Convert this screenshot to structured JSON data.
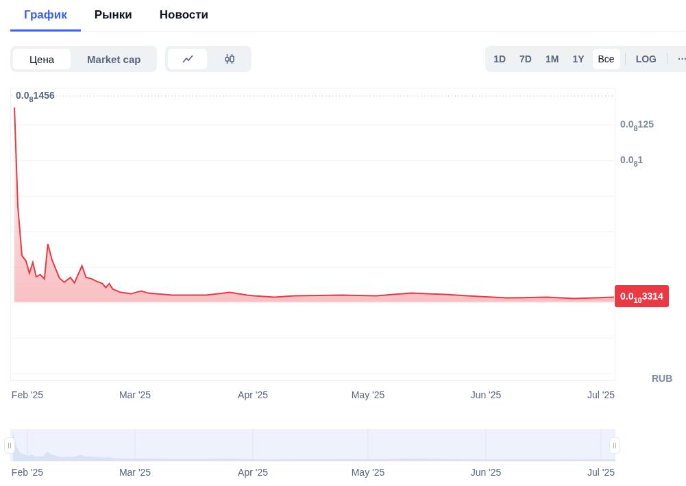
{
  "tabs": [
    {
      "label": "График",
      "selected": true
    },
    {
      "label": "Рынки",
      "selected": false
    },
    {
      "label": "Новости",
      "selected": false
    }
  ],
  "toolbar": {
    "metric": [
      {
        "label": "Цена",
        "selected": true
      },
      {
        "label": "Market cap",
        "selected": false
      }
    ],
    "chart_type": [
      {
        "kind": "line",
        "selected": true
      },
      {
        "kind": "candles",
        "selected": false
      }
    ],
    "ranges": [
      {
        "label": "1D",
        "selected": false
      },
      {
        "label": "7D",
        "selected": false
      },
      {
        "label": "1M",
        "selected": false
      },
      {
        "label": "1Y",
        "selected": false
      },
      {
        "label": "Все",
        "selected": true
      }
    ],
    "scale": {
      "label": "LOG",
      "selected": false
    },
    "more": "···"
  },
  "chart": {
    "max_label": "0.0$_{8}$1456",
    "y_axis_labels": [
      "0.0$_{8}$125",
      "0.0$_{8}$1"
    ],
    "price_tag": "0.0$_{10}$3314",
    "currency": "RUB",
    "x_axis_labels": [
      "Feb '25",
      "Mar '25",
      "Apr '25",
      "May '25",
      "Jun '25",
      "Jul '25"
    ]
  },
  "navigator": {
    "labels": [
      "Feb '25",
      "Mar '25",
      "Apr '25",
      "May '25",
      "Jun '25",
      "Jul '25"
    ]
  }
}
